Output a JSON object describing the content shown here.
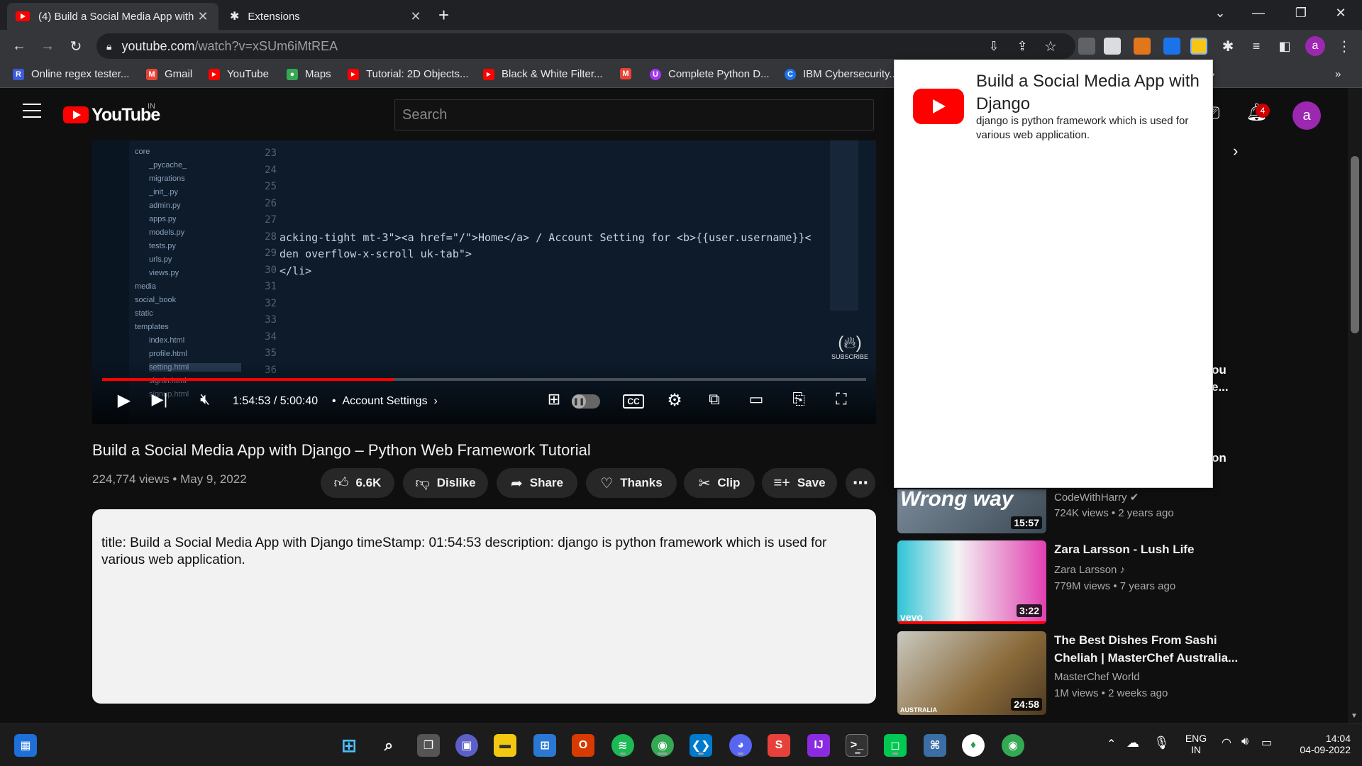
{
  "browser": {
    "tabs": [
      {
        "title": "(4) Build a Social Media App with",
        "active": true
      },
      {
        "title": "Extensions",
        "active": false
      }
    ],
    "new_tab": "+",
    "url_host": "youtube.com",
    "url_path": "/watch?v=xSUm6iMtREA",
    "profile_initial": "a",
    "bookmarks": [
      {
        "label": "Online regex tester...",
        "icon": "R",
        "color": "#3b5bdb"
      },
      {
        "label": "Gmail",
        "icon": "M",
        "color": "#ea4335"
      },
      {
        "label": "YouTube",
        "icon": "▶",
        "color": "#ff0000"
      },
      {
        "label": "Maps",
        "icon": "●",
        "color": "#34a853"
      },
      {
        "label": "Tutorial: 2D Objects...",
        "icon": "▶",
        "color": "#ff0000"
      },
      {
        "label": "Black & White Filter...",
        "icon": "▶",
        "color": "#ff0000"
      },
      {
        "label": "",
        "icon": "M",
        "color": "#ea4335"
      },
      {
        "label": "Complete Python D...",
        "icon": "U",
        "color": "#a435f0"
      },
      {
        "label": "IBM Cybersecurity...",
        "icon": "C",
        "color": "#1a73e8"
      }
    ],
    "bookmarks_more": "»"
  },
  "youtube": {
    "logo_text": "YouTube",
    "logo_region": "IN",
    "search_placeholder": "Search",
    "notification_count": "4",
    "avatar_initial": "a"
  },
  "player": {
    "code_lines": [
      {
        "no": "23",
        "text": ""
      },
      {
        "no": "24",
        "text": ""
      },
      {
        "no": "25",
        "text": ""
      },
      {
        "no": "26",
        "text": ""
      },
      {
        "no": "27",
        "text": ""
      },
      {
        "no": "28",
        "text": "acking-tight mt-3\"><a href=\"/\">Home</a> / Account Setting for <b>{{user.username}}<"
      },
      {
        "no": "29",
        "text": "den overflow-x-scroll uk-tab\">"
      },
      {
        "no": "30",
        "text": "</li>"
      },
      {
        "no": "31",
        "text": ""
      },
      {
        "no": "32",
        "text": ""
      },
      {
        "no": "33",
        "text": ""
      },
      {
        "no": "34",
        "text": ""
      },
      {
        "no": "35",
        "text": ""
      },
      {
        "no": "36",
        "text": ""
      }
    ],
    "file_tree": [
      "core",
      "_pycache_",
      "migrations",
      "_init_.py",
      "admin.py",
      "apps.py",
      "models.py",
      "tests.py",
      "urls.py",
      "views.py",
      "media",
      "social_book",
      "static",
      "templates",
      "index.html",
      "profile.html",
      "setting.html",
      "signin.html",
      "signup.html"
    ],
    "subscribe_label": "SUBSCRIBE",
    "time_current": "1:54:53",
    "time_total": "5:00:40",
    "chapter": "Account Settings",
    "progress": 0.382,
    "cc_label": "CC"
  },
  "video": {
    "title": "Build a Social Media App with Django – Python Web Framework Tutorial",
    "views": "224,774 views",
    "date": "May 9, 2022",
    "likes": "6.6K",
    "dislike_label": "Dislike",
    "share_label": "Share",
    "thanks_label": "Thanks",
    "clip_label": "Clip",
    "save_label": "Save",
    "description": "title: Build a Social Media App with Django timeStamp: 01:54:53 description: django is python framework which is used for various web application."
  },
  "popup": {
    "title": "Build a Social Media App with Django",
    "description": "django is python framework which is used for various web application."
  },
  "sidebar": {
    "partial_texts": [
      "ou",
      "e...",
      "on"
    ],
    "recommendations": [
      {
        "title": "",
        "channel": "CodeWithHarry",
        "verified": true,
        "meta": "724K views • 2 years ago",
        "duration": "15:57",
        "thumb_text": "Wrong way"
      },
      {
        "title": "Zara Larsson - Lush Life",
        "channel": "Zara Larsson",
        "music": true,
        "meta": "779M views • 7 years ago",
        "duration": "3:22",
        "thumb_text": "vevo"
      },
      {
        "title": "The Best Dishes From Sashi Cheliah | MasterChef Australia...",
        "channel": "MasterChef World",
        "meta": "1M views • 2 weeks ago",
        "duration": "24:58",
        "thumb_text": "AUSTRALIA"
      }
    ]
  },
  "taskbar": {
    "lang": "ENG",
    "region": "IN",
    "time": "14:04",
    "date": "04-09-2022"
  },
  "colors": {
    "accent_red": "#ff0000",
    "yt_bg": "#0f0f0f",
    "pill_bg": "#272727",
    "chrome_dark": "#202124",
    "chrome_toolbar": "#35363a",
    "avatar": "#9c27b0"
  }
}
